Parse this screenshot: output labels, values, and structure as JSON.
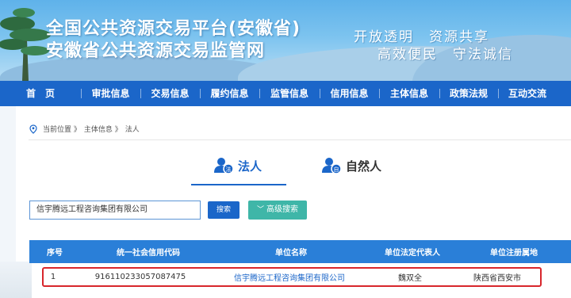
{
  "header": {
    "title_line1": "全国公共资源交易平台(安徽省)",
    "title_line2": "安徽省公共资源交易监管网",
    "slogan_line1": "开放透明　资源共享",
    "slogan_line2": "高效便民　守法诚信"
  },
  "nav": {
    "items": [
      {
        "label": "首　页"
      },
      {
        "label": "审批信息"
      },
      {
        "label": "交易信息"
      },
      {
        "label": "履约信息"
      },
      {
        "label": "监管信息"
      },
      {
        "label": "信用信息"
      },
      {
        "label": "主体信息"
      },
      {
        "label": "政策法规"
      },
      {
        "label": "互动交流"
      }
    ]
  },
  "breadcrumb": {
    "prefix": "当前位置 》",
    "level1": "主体信息 》",
    "level2": "法人"
  },
  "tabs": {
    "legal": "法人",
    "natural": "自然人"
  },
  "search": {
    "value": "信宇腾远工程咨询集团有限公司",
    "button": "搜索",
    "advanced": "高级搜索"
  },
  "table": {
    "headers": [
      "序号",
      "统一社会信用代码",
      "单位名称",
      "单位法定代表人",
      "单位注册属地"
    ],
    "rows": [
      [
        "1",
        "91611023305708747​5",
        "信宇腾远工程咨询集团有限公司",
        "魏双全",
        "陕西省西安市"
      ]
    ]
  },
  "colors": {
    "nav_blue": "#1b66c9",
    "table_header": "#2a7fd8",
    "highlight_border": "#d8262c",
    "advanced_button": "#3fb6a8"
  }
}
